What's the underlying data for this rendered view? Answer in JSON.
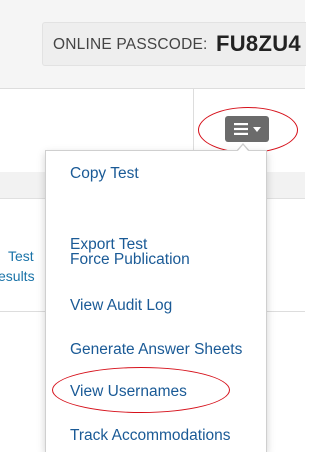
{
  "header": {
    "passcode_label": "ONLINE PASSCODE:",
    "passcode_value": "FU8ZU4"
  },
  "background": {
    "partial_text_1": "Test",
    "partial_text_2": "esults"
  },
  "menu_button": {
    "icon": "hamburger-icon",
    "caret_icon": "caret-down-icon"
  },
  "dropdown": {
    "items": [
      "Copy Test",
      "Export Test",
      "Force Publication",
      "View Audit Log",
      "Generate Answer Sheets",
      "View Usernames",
      "Track Accommodations"
    ]
  },
  "colors": {
    "link": "#1a5a96",
    "button": "#6b6b6b",
    "annotation": "#d6101a"
  }
}
